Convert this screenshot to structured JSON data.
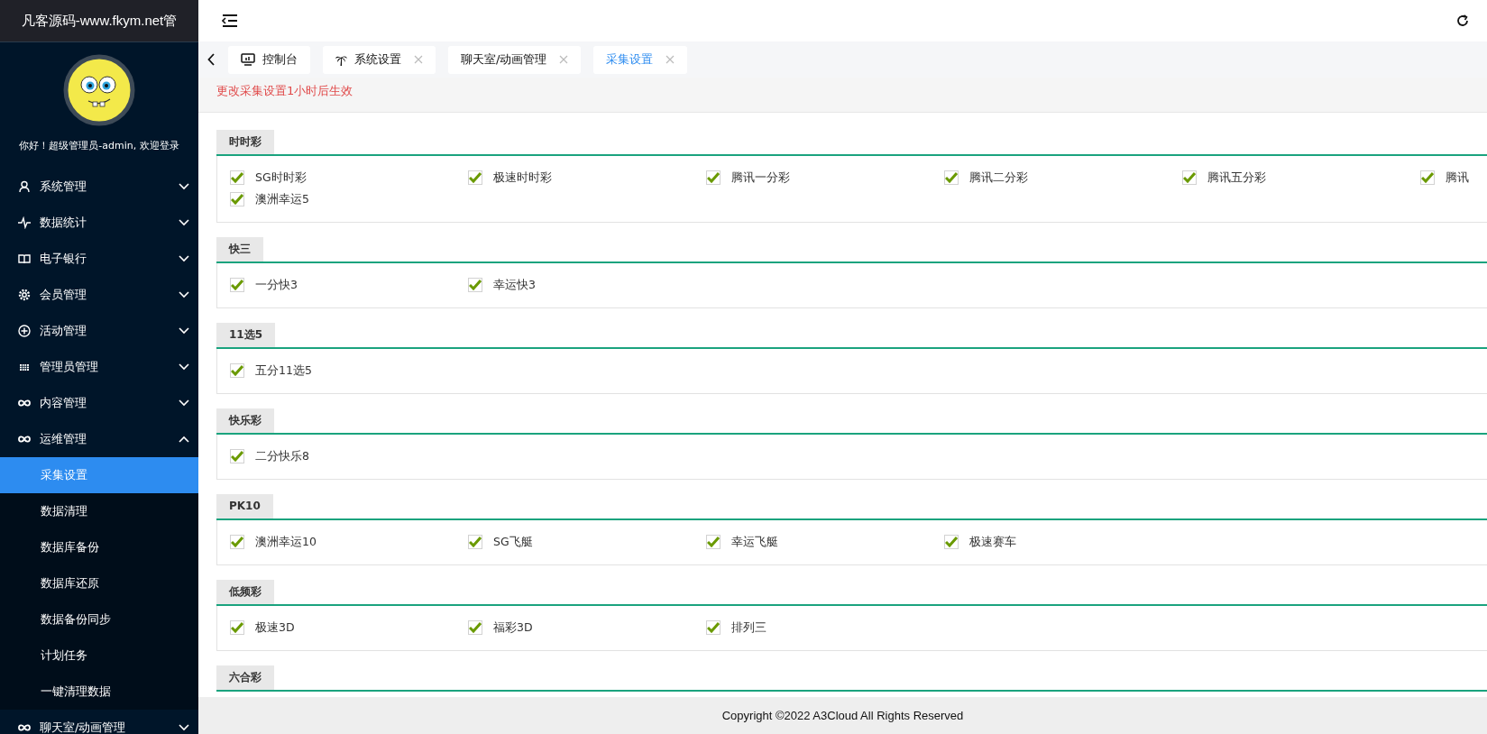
{
  "sidebar": {
    "title": "凡客源码-www.fkym.net管",
    "greeting": "你好！超级管理员-admin, 欢迎登录",
    "items": [
      {
        "label": "系统管理",
        "expanded": false
      },
      {
        "label": "数据统计",
        "expanded": false
      },
      {
        "label": "电子银行",
        "expanded": false
      },
      {
        "label": "会员管理",
        "expanded": false
      },
      {
        "label": "活动管理",
        "expanded": false
      },
      {
        "label": "管理员管理",
        "expanded": false
      },
      {
        "label": "内容管理",
        "expanded": false
      },
      {
        "label": "运维管理",
        "expanded": true,
        "children": [
          {
            "label": "采集设置",
            "selected": true
          },
          {
            "label": "数据清理",
            "selected": false
          },
          {
            "label": "数据库备份",
            "selected": false
          },
          {
            "label": "数据库还原",
            "selected": false
          },
          {
            "label": "数据备份同步",
            "selected": false
          },
          {
            "label": "计划任务",
            "selected": false
          },
          {
            "label": "一键清理数据",
            "selected": false
          }
        ]
      },
      {
        "label": "聊天室/动画管理",
        "expanded": false
      }
    ]
  },
  "tabs": [
    {
      "label": "控制台",
      "selected": false,
      "closable": false
    },
    {
      "label": "系统设置",
      "selected": false,
      "closable": true
    },
    {
      "label": "聊天室/动画管理",
      "selected": false,
      "closable": true
    },
    {
      "label": "采集设置",
      "selected": true,
      "closable": true
    }
  ],
  "notice": "更改采集设置1小时后生效",
  "sections": [
    {
      "title": "时时彩",
      "items": [
        {
          "label": "SG时时彩",
          "checked": true
        },
        {
          "label": "极速时时彩",
          "checked": true
        },
        {
          "label": "腾讯一分彩",
          "checked": true
        },
        {
          "label": "腾讯二分彩",
          "checked": true
        },
        {
          "label": "腾讯五分彩",
          "checked": true
        },
        {
          "label": "腾讯",
          "checked": true
        },
        {
          "label": "澳洲幸运5",
          "checked": true
        }
      ]
    },
    {
      "title": "快三",
      "items": [
        {
          "label": "一分快3",
          "checked": true
        },
        {
          "label": "幸运快3",
          "checked": true
        }
      ]
    },
    {
      "title": "11选5",
      "items": [
        {
          "label": "五分11选5",
          "checked": true
        }
      ]
    },
    {
      "title": "快乐彩",
      "items": [
        {
          "label": "二分快乐8",
          "checked": true
        }
      ]
    },
    {
      "title": "PK10",
      "items": [
        {
          "label": "澳洲幸运10",
          "checked": true
        },
        {
          "label": "SG飞艇",
          "checked": true
        },
        {
          "label": "幸运飞艇",
          "checked": true
        },
        {
          "label": "极速赛车",
          "checked": true
        }
      ]
    },
    {
      "title": "低频彩",
      "items": [
        {
          "label": "极速3D",
          "checked": true
        },
        {
          "label": "福彩3D",
          "checked": true
        },
        {
          "label": "排列三",
          "checked": true
        }
      ]
    },
    {
      "title": "六合彩"
    }
  ],
  "footer": "Copyright ©2022 A3Cloud All Rights Reserved"
}
